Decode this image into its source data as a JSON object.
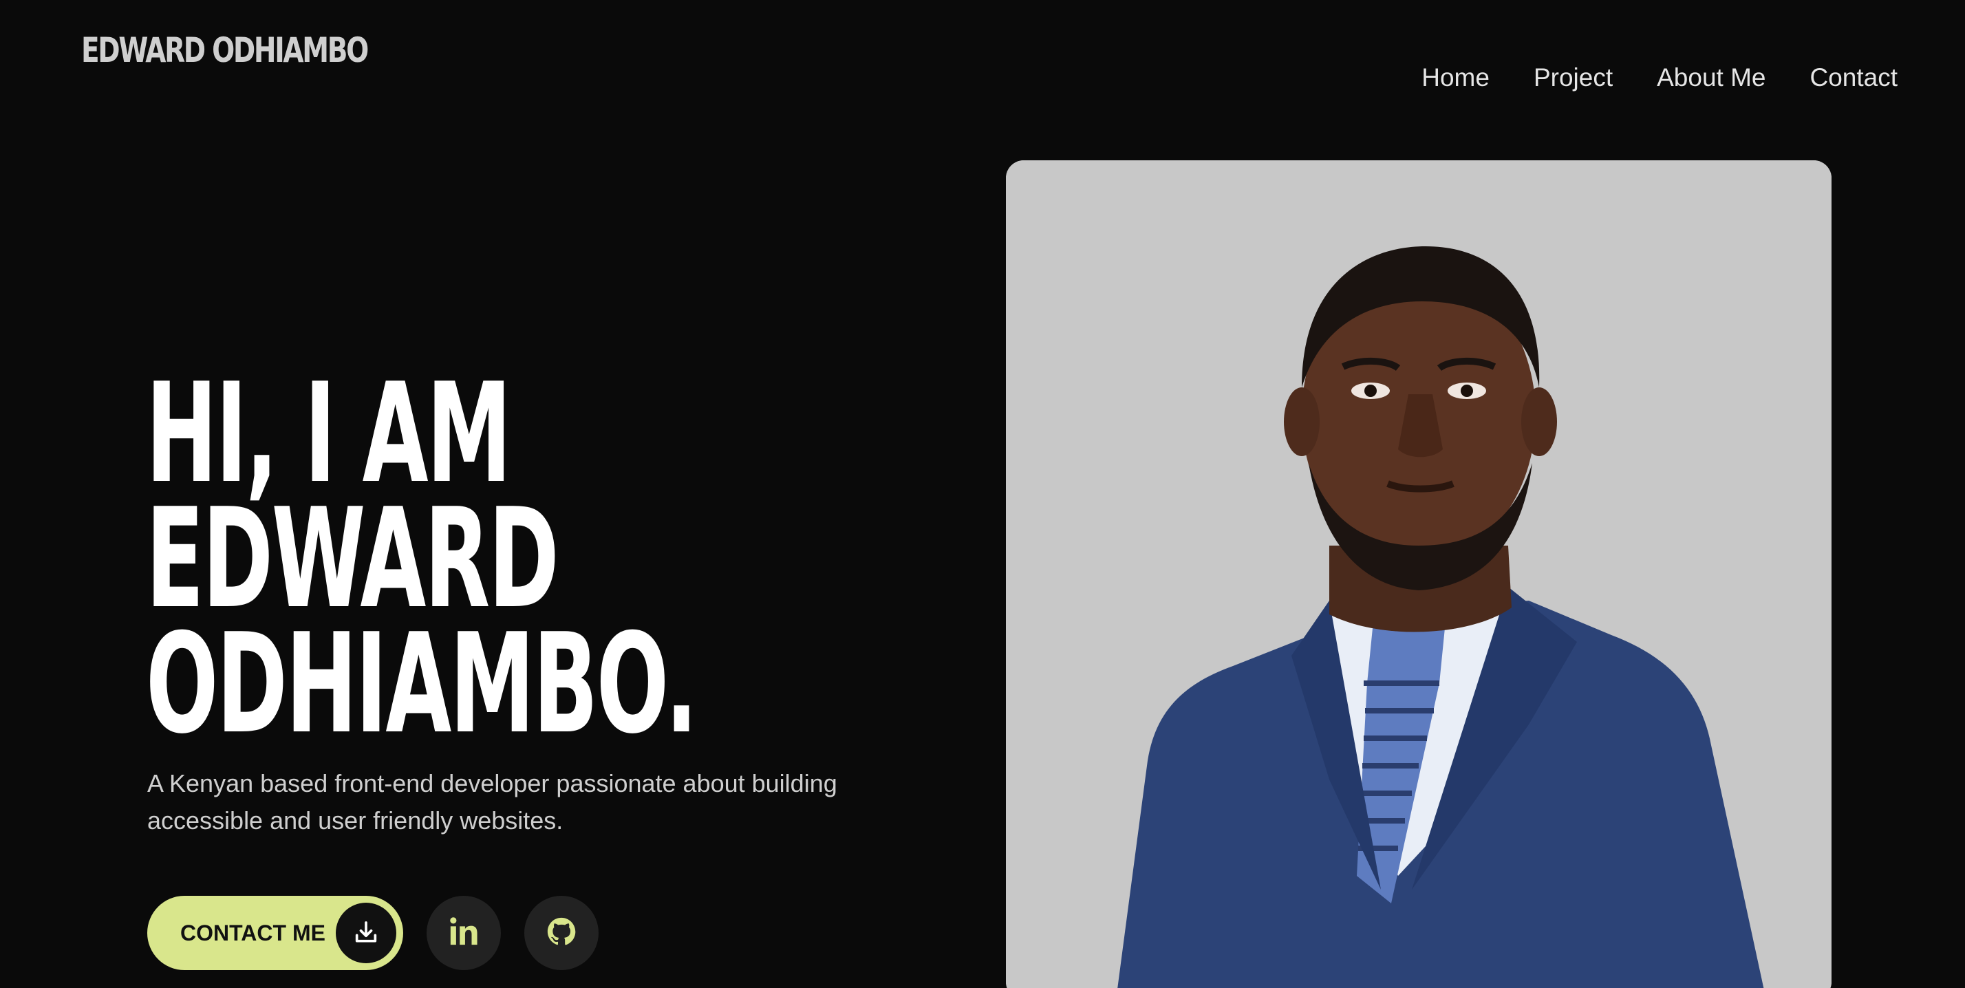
{
  "header": {
    "logo": "EDWARD ODHIAMBO",
    "nav": [
      {
        "label": "Home"
      },
      {
        "label": "Project"
      },
      {
        "label": "About Me"
      },
      {
        "label": "Contact"
      }
    ]
  },
  "hero": {
    "title_lines": [
      "HI, I AM",
      "EDWARD",
      "ODHIAMBO."
    ],
    "tagline": "A Kenyan based front-end developer passionate about building accessible and user friendly websites.",
    "contact_label": "CONTACT ME",
    "contact_icon": "download-icon",
    "social": [
      {
        "name": "linkedin-icon"
      },
      {
        "name": "github-icon"
      }
    ]
  },
  "portrait": {
    "subject": "man in navy suit with blue striped tie",
    "background_color": "#c8c8c8"
  },
  "colors": {
    "background": "#0a0a0a",
    "accent": "#d9e68c",
    "text": "#ffffff",
    "muted_text": "#cfcfcf"
  }
}
